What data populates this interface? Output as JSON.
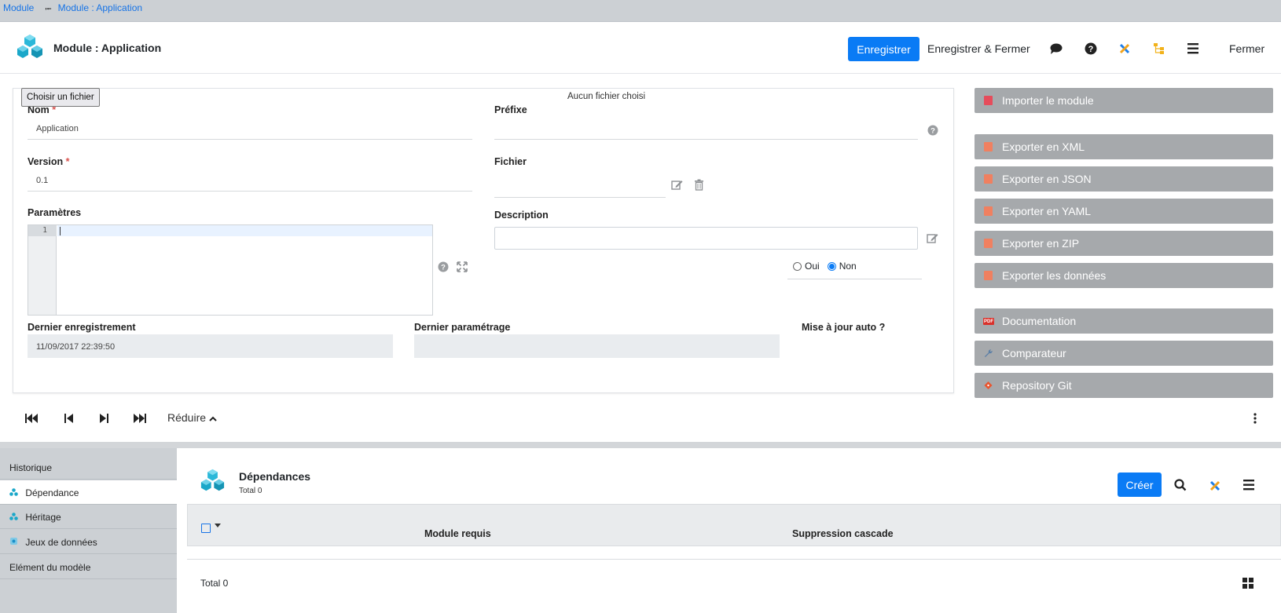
{
  "breadcrumb": {
    "root": "Module",
    "current": "Module : Application"
  },
  "header": {
    "title": "Module : Application",
    "save_label": "Enregistrer",
    "save_close_label": "Enregistrer & Fermer",
    "close_label": "Fermer"
  },
  "form": {
    "nom": {
      "label": "Nom",
      "required": "*",
      "value": "Application"
    },
    "prefixe": {
      "label": "Préfixe",
      "value": ""
    },
    "version": {
      "label": "Version",
      "required": "*",
      "value": "0.1"
    },
    "fichier": {
      "label": "Fichier",
      "button": "Choisir un fichier",
      "status": "Aucun fichier choisi"
    },
    "parametres": {
      "label": "Paramètres",
      "line_number": "1"
    },
    "description": {
      "label": "Description",
      "value": ""
    },
    "dernier_enregistrement": {
      "label": "Dernier enregistrement",
      "value": "11/09/2017 22:39:50"
    },
    "dernier_parametrage": {
      "label": "Dernier paramétrage",
      "value": ""
    },
    "mise_a_jour": {
      "label": "Mise à jour auto ?",
      "options": [
        "Oui",
        "Non"
      ],
      "selected": "Non"
    }
  },
  "actions": [
    {
      "label": "Importer le module",
      "icon": "import-icon"
    },
    {
      "label": "Exporter en XML",
      "icon": "export-icon"
    },
    {
      "label": "Exporter en JSON",
      "icon": "export-icon"
    },
    {
      "label": "Exporter en YAML",
      "icon": "export-icon"
    },
    {
      "label": "Exporter en ZIP",
      "icon": "export-icon"
    },
    {
      "label": "Exporter les données",
      "icon": "export-icon"
    },
    {
      "label": "Documentation",
      "icon": "pdf-icon",
      "icon_text": "PDF"
    },
    {
      "label": "Comparateur",
      "icon": "wrench-icon"
    },
    {
      "label": "Repository Git",
      "icon": "git-icon"
    }
  ],
  "pager": {
    "reduce_label": "Réduire"
  },
  "sidebar": {
    "items": [
      {
        "label": "Historique"
      },
      {
        "label": "Dépendance"
      },
      {
        "label": "Héritage"
      },
      {
        "label": "Jeux de données"
      },
      {
        "label": "Elément du modèle"
      }
    ]
  },
  "panel": {
    "title": "Dépendances",
    "subtitle": "Total 0",
    "create_label": "Créer",
    "columns": [
      "Module requis",
      "Suppression cascade"
    ],
    "footer_total": "Total 0"
  },
  "colors": {
    "primary": "#0a7bf5",
    "link": "#1673e6",
    "side_button": "#a6a9ac",
    "required": "#d9534f",
    "teal": "#1aa7c9"
  }
}
